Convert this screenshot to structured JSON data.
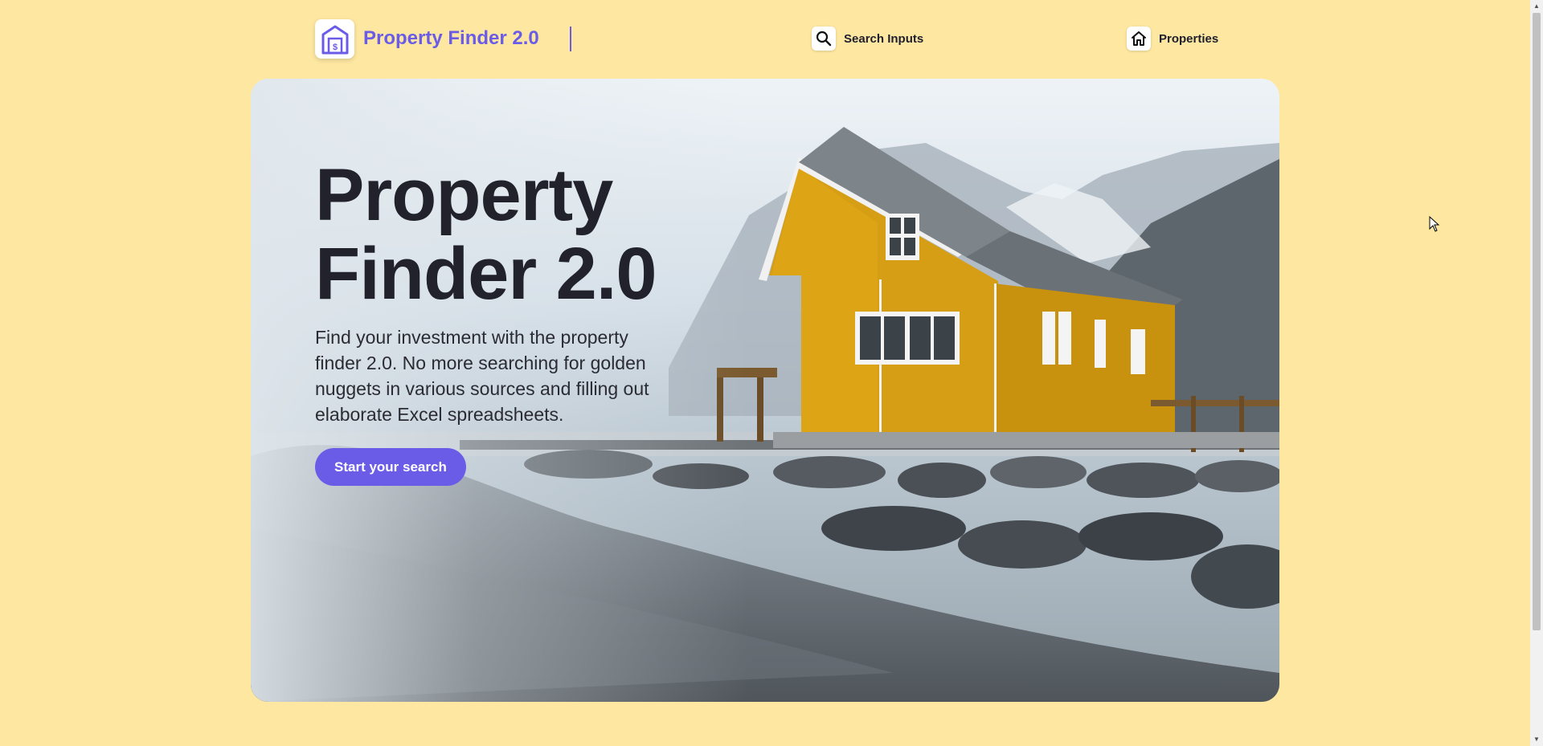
{
  "nav": {
    "brand": "Property Finder 2.0",
    "links": [
      {
        "label": "Search Inputs",
        "icon": "search-icon"
      },
      {
        "label": "Properties",
        "icon": "home-icon"
      }
    ]
  },
  "hero": {
    "title_line1": "Property",
    "title_line2": "Finder 2.0",
    "description": "Find your investment with the property finder 2.0. No more searching for golden nuggets in various sources and filling out elaborate Excel spreadsheets.",
    "cta_label": "Start your search"
  },
  "colors": {
    "background": "#fde7a1",
    "accent": "#6b5ce7",
    "text_dark": "#22222c"
  }
}
